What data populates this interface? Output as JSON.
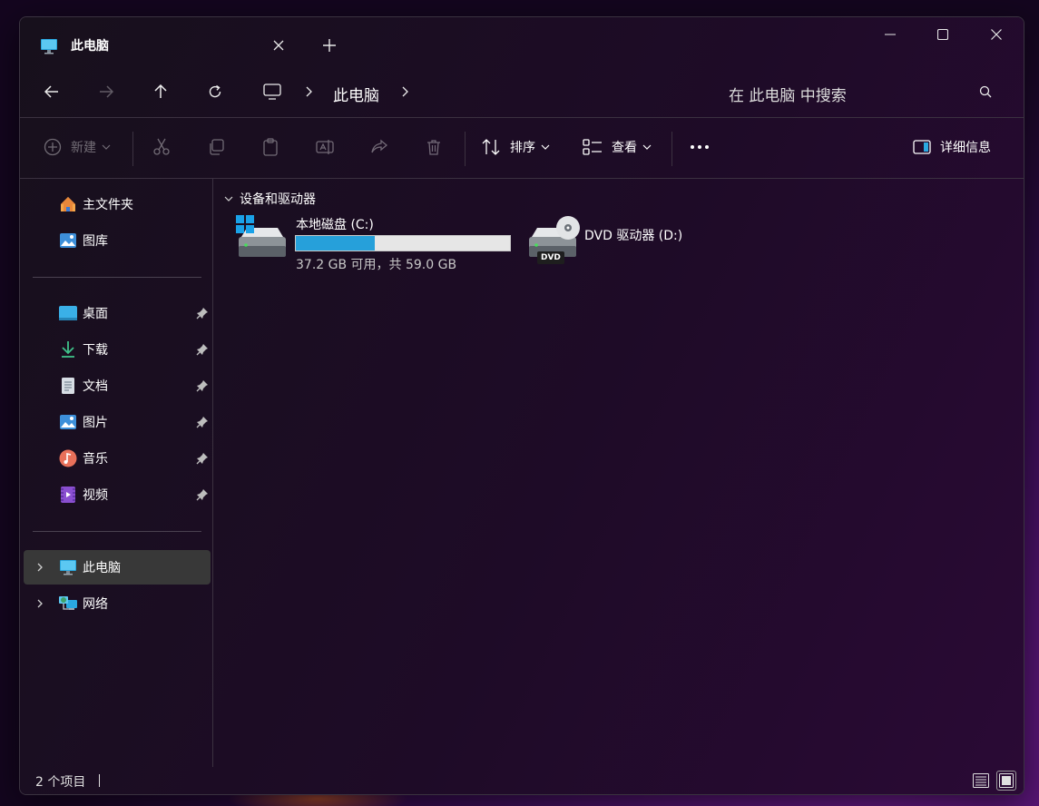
{
  "window": {
    "tab": {
      "title": "此电脑"
    },
    "controls": {
      "minimize": "minimize",
      "maximize": "maximize",
      "close": "close"
    }
  },
  "navbar": {
    "breadcrumb": [
      "此电脑"
    ],
    "search_placeholder": "在 此电脑 中搜索"
  },
  "commands": {
    "new_label": "新建",
    "sort_label": "排序",
    "view_label": "查看",
    "details_label": "详细信息"
  },
  "sidebar": {
    "quick": [
      {
        "label": "主文件夹",
        "icon": "home-icon"
      },
      {
        "label": "图库",
        "icon": "gallery-icon"
      }
    ],
    "pinned": [
      {
        "label": "桌面",
        "icon": "desktop-icon"
      },
      {
        "label": "下载",
        "icon": "download-icon"
      },
      {
        "label": "文档",
        "icon": "document-icon"
      },
      {
        "label": "图片",
        "icon": "pictures-icon"
      },
      {
        "label": "音乐",
        "icon": "music-icon"
      },
      {
        "label": "视频",
        "icon": "video-icon"
      }
    ],
    "tree": [
      {
        "label": "此电脑",
        "icon": "computer-icon",
        "selected": true
      },
      {
        "label": "网络",
        "icon": "network-icon",
        "selected": false
      }
    ]
  },
  "content": {
    "group_title": "设备和驱动器",
    "drives": [
      {
        "name": "本地磁盘 (C:)",
        "free_text": "37.2 GB 可用，共 59.0 GB",
        "used_fraction": 0.37,
        "icon": "windows-drive-icon"
      },
      {
        "name": "DVD 驱动器 (D:)",
        "icon": "dvd-drive-icon",
        "badge": "DVD"
      }
    ]
  },
  "status": {
    "item_count": "2 个项目"
  },
  "colors": {
    "accent": "#26a0da",
    "selected_bg": "#383838"
  }
}
